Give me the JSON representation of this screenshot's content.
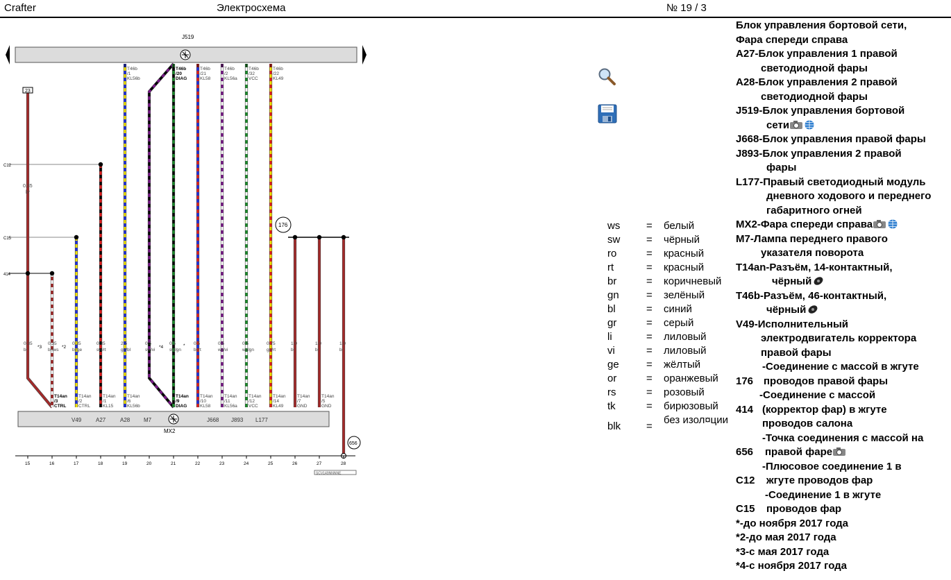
{
  "header": {
    "model": "Crafter",
    "title": "Электросхема",
    "number": "№  19 / 3"
  },
  "diagram": {
    "module_top": "J519",
    "module_bottom": "MX2",
    "ref_23": "23",
    "ref_176": "176",
    "ref_656": "656",
    "side_labels": {
      "c12": "C12",
      "c15": "C15",
      "r414": "414"
    },
    "mid_wire_label": [
      "0.35",
      "br"
    ],
    "top_pins": [
      [
        "T46b",
        "/1",
        "KL56b"
      ],
      [
        "T46b",
        "/20",
        "DIAG"
      ],
      [
        "T46b",
        "/21",
        "KL58"
      ],
      [
        "T46b",
        "/2",
        "KL56a"
      ],
      [
        "T46b",
        "/32",
        "VCC"
      ],
      [
        "T46b",
        "/22",
        "KL49"
      ]
    ],
    "wire_labels": [
      [
        "0.35",
        "br"
      ],
      [
        "0.35",
        "br/ws"
      ],
      [
        "0.35",
        "bl/ge"
      ],
      [
        "0.35",
        "sw/rt"
      ],
      [
        "2.5",
        "ge/bl"
      ],
      [
        "0.5",
        "sw/vi"
      ],
      [
        "0.5",
        "sw/gn"
      ],
      [
        "0.5",
        "bl/rt"
      ],
      [
        "0.5",
        "ws/vi"
      ],
      [
        "0.5",
        "ws/gn"
      ],
      [
        "0.75",
        "ge/rt"
      ],
      [
        "1.0",
        "br"
      ],
      [
        "1.0",
        "br"
      ],
      [
        "1.0",
        "br"
      ]
    ],
    "notes": [
      "*3",
      "*2",
      "*4",
      "*"
    ],
    "bottom_pins": [
      [
        "T14an",
        "/3",
        "CTRL"
      ],
      [
        "T14an",
        "/2",
        "CTRL"
      ],
      [
        "T14an",
        "/1",
        "KL15"
      ],
      [
        "T14an",
        "/6",
        "KL56b"
      ],
      [
        "T14an",
        "/9",
        "DIAG"
      ],
      [
        "T14an",
        "/10",
        "KL58"
      ],
      [
        "T14an",
        "/11",
        "KL56a"
      ],
      [
        "T14an",
        "/12",
        "VCC"
      ],
      [
        "T14an",
        "/14",
        "KL49"
      ],
      [
        "T14an",
        "/7",
        "GND"
      ],
      [
        "T14an",
        "/5",
        "GND"
      ]
    ],
    "sub_components": [
      "V49",
      "A27",
      "A28",
      "M7",
      "J668",
      "J893",
      "L177"
    ],
    "scale": [
      "15",
      "16",
      "17",
      "18",
      "19",
      "20",
      "21",
      "22",
      "23",
      "24",
      "25",
      "26",
      "27",
      "28"
    ],
    "footer_code": "SCV149NNNNE"
  },
  "tools": {
    "search": "search-icon",
    "save": "save-icon"
  },
  "colors": [
    {
      "code": "ws",
      "eq": "=",
      "name": "белый"
    },
    {
      "code": "sw",
      "eq": "=",
      "name": "чёрный"
    },
    {
      "code": "ro",
      "eq": "=",
      "name": "красный"
    },
    {
      "code": "rt",
      "eq": "=",
      "name": "красный"
    },
    {
      "code": "br",
      "eq": "=",
      "name": "коричневый"
    },
    {
      "code": "gn",
      "eq": "=",
      "name": "зелёный"
    },
    {
      "code": "bl",
      "eq": "=",
      "name": "синий"
    },
    {
      "code": "gr",
      "eq": "=",
      "name": "серый"
    },
    {
      "code": "li",
      "eq": "=",
      "name": "лиловый"
    },
    {
      "code": "vi",
      "eq": "=",
      "name": "лиловый"
    },
    {
      "code": "ge",
      "eq": "=",
      "name": "жёлтый"
    },
    {
      "code": "or",
      "eq": "=",
      "name": "оранжевый"
    },
    {
      "code": "rs",
      "eq": "=",
      "name": "розовый"
    },
    {
      "code": "tk",
      "eq": "=",
      "name": "бирюзовый"
    },
    {
      "code": "blk",
      "eq": "=",
      "name": "без изол¤ции"
    }
  ],
  "components": {
    "heading": [
      "Блок управления бортовой сети,",
      "Фара спереди справа"
    ],
    "a27": {
      "code": "A27-",
      "l1": "Блок управления 1 правой",
      "l2": "светодиодной фары"
    },
    "a28": {
      "code": "A28-",
      "l1": "Блок управления 2 правой",
      "l2": "светодиодной фары"
    },
    "j519": {
      "code": "J519-",
      "l1": "Блок управления бортовой",
      "l2": "сети"
    },
    "j668": {
      "code": "J668-",
      "l1": "Блок управления правой фары"
    },
    "j893": {
      "code": "J893-",
      "l1": "Блок управления 2 правой",
      "l2": "фары"
    },
    "l177": {
      "code": "L177-",
      "l1": "Правый светодиодный модуль",
      "l2": "дневного ходового и переднего",
      "l3": "габаритного огней"
    },
    "mx2": {
      "code": "MX2-",
      "l1": "Фара спереди справа"
    },
    "m7": {
      "code": "M7-",
      "l1": "Лампа переднего правого",
      "l2": "указателя поворота"
    },
    "t14an": {
      "code": "T14an-",
      "l1": "Разъём, 14-контактный,",
      "l2": "чёрный"
    },
    "t46b": {
      "code": "T46b-",
      "l1": "Разъём, 46-контактный,",
      "l2": "чёрный"
    },
    "v49": {
      "code": "V49-",
      "l1": "Исполнительный",
      "l2": "электродвигатель корректора",
      "l3": "правой фары"
    },
    "g176": {
      "l1": "-Соединение с массой в жгуте",
      "code": "176",
      "l2": "проводов правой фары"
    },
    "g414": {
      "l1": "-Соединение с массой",
      "code": "414",
      "l2": "(корректор фар) в жгуте",
      "l3": "проводов салона"
    },
    "g656": {
      "l1": "-Точка соединения с массой на",
      "code": "656",
      "l2": "правой фаре"
    },
    "c12": {
      "l1": "-Плюсовое соединение 1 в",
      "code": "C12",
      "l2": "жгуте проводов фар"
    },
    "c15": {
      "l1": "-Соединение 1 в жгуте",
      "code": "C15",
      "l2": "проводов фар"
    },
    "notes": [
      "*-до ноября 2017 года",
      "*2-до мая 2017 года",
      "*3-с мая 2017 года",
      "*4-с ноября 2017 года"
    ]
  }
}
